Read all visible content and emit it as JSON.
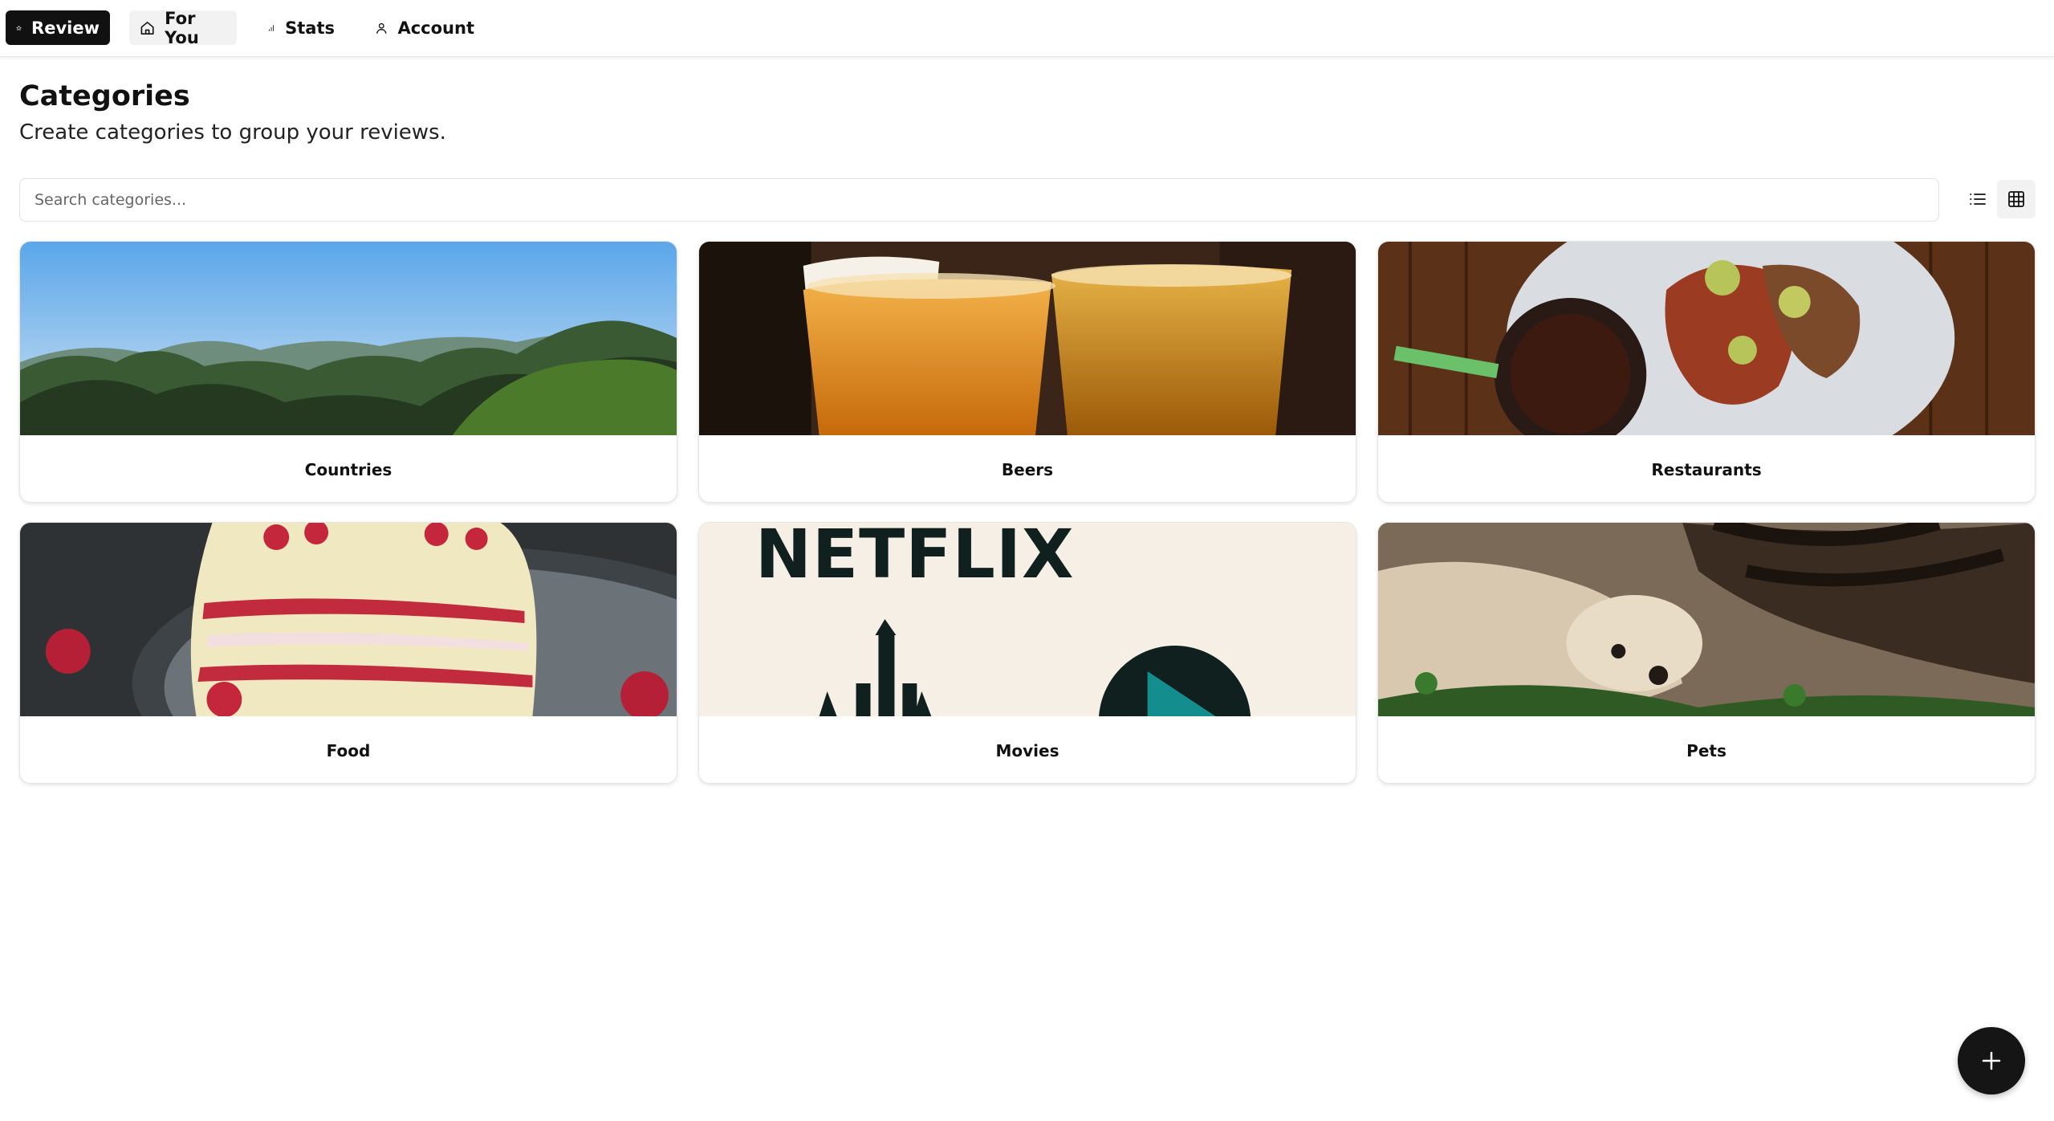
{
  "nav": {
    "items": [
      {
        "label": "Review",
        "icon": "star-icon",
        "active": true
      },
      {
        "label": "For You",
        "icon": "home-icon"
      },
      {
        "label": "Stats",
        "icon": "bar-chart-icon"
      },
      {
        "label": "Account",
        "icon": "user-icon"
      }
    ]
  },
  "header": {
    "title": "Categories",
    "subtitle": "Create categories to group your reviews."
  },
  "search": {
    "placeholder": "Search categories...",
    "value": ""
  },
  "view_toggle": {
    "options": [
      "list-icon",
      "grid-icon"
    ],
    "selected": "grid"
  },
  "categories": [
    {
      "label": "Countries",
      "image": "mountain landscape"
    },
    {
      "label": "Beers",
      "image": "two glasses of beer"
    },
    {
      "label": "Restaurants",
      "image": "plated dish on wooden table"
    },
    {
      "label": "Food",
      "image": "slice of raspberry cake"
    },
    {
      "label": "Movies",
      "image": "streaming logos",
      "image_text": "NETFLIX"
    },
    {
      "label": "Pets",
      "image": "cat and dog"
    }
  ],
  "fab": {
    "icon": "plus-icon"
  },
  "colors": {
    "accent": "#111111",
    "active_nav_bg": "#111111",
    "hover_nav_bg": "#f2f2f2"
  }
}
